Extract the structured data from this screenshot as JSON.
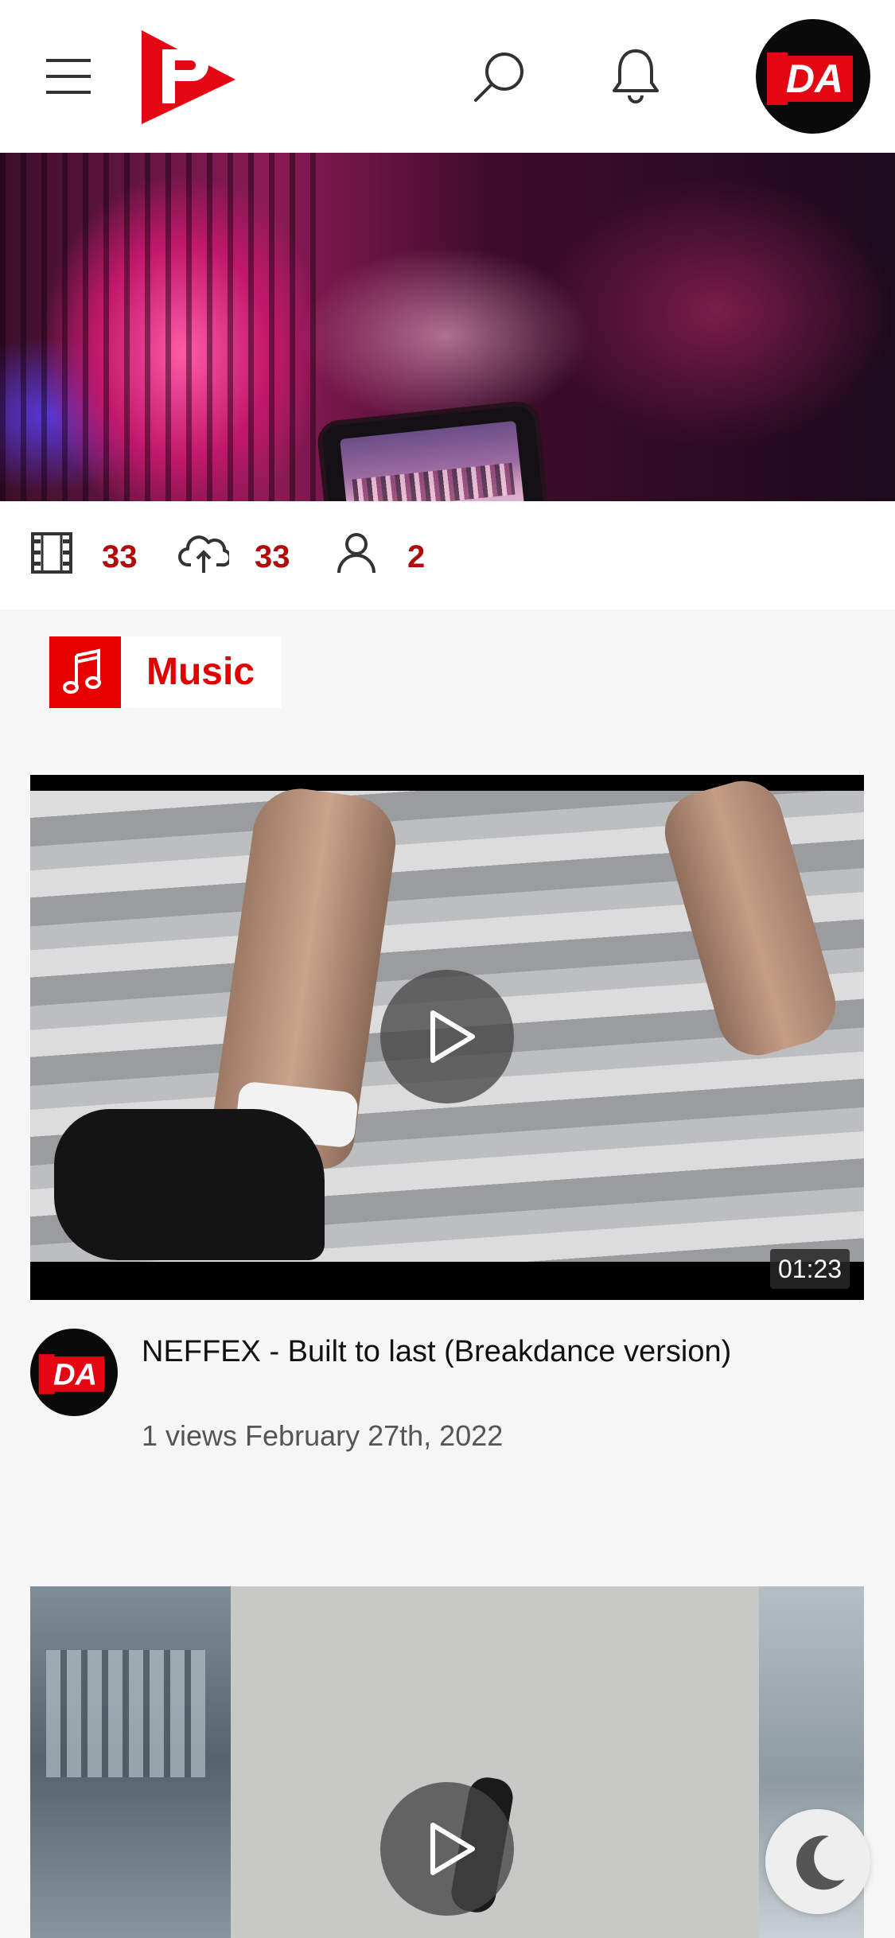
{
  "header": {
    "menu_icon": "hamburger-menu-icon",
    "logo_icon": "play-logo-icon",
    "search_icon": "search-icon",
    "notification_icon": "bell-icon",
    "avatar_text": "DA"
  },
  "stats": {
    "videos_icon": "film-icon",
    "videos_count": "33",
    "uploads_icon": "cloud-upload-icon",
    "uploads_count": "33",
    "users_icon": "user-icon",
    "users_count": "2"
  },
  "category": {
    "icon": "music-note-icon",
    "label": "Music"
  },
  "videos": [
    {
      "title": "NEFFEX - Built to last (Breakdance version)",
      "duration": "01:23",
      "meta": "1 views February 27th, 2022",
      "channel_avatar_text": "DA"
    },
    {
      "title": "",
      "duration": ""
    }
  ],
  "theme_toggle_icon": "moon-icon",
  "colors": {
    "accent": "#e60000",
    "stat_number": "#b00b0b",
    "background": "#f6f6f6"
  }
}
